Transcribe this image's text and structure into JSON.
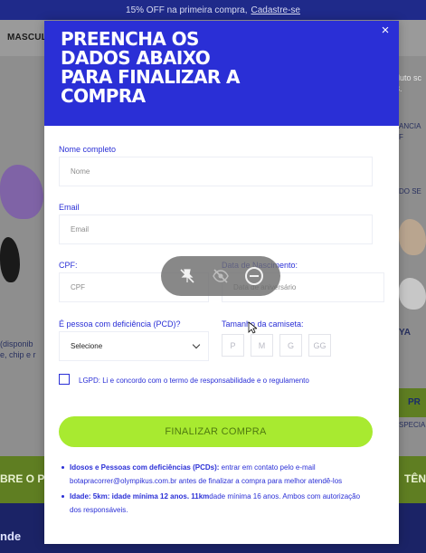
{
  "promo": {
    "text": "15% OFF na primeira compra,",
    "link": "Cadastre-se"
  },
  "background": {
    "nav_left": "MASCULI",
    "right_note": "duto sc 3.",
    "right_tab": "ANCIA F",
    "right_de": "DO SE",
    "left_text_1": "(disponib",
    "left_text_2": "e, chip e r",
    "right_ya": "YA",
    "right_btn": "PR",
    "right_special": "SPECIA",
    "green_left": "BRE O P",
    "green_right": "TÊN",
    "bottom_left": "nde"
  },
  "modal": {
    "title": "PREENCHA OS DADOS ABAIXO PARA FINALIZAR A COMPRA",
    "close_label": "×",
    "fields": {
      "name": {
        "label": "Nome completo",
        "placeholder": "Nome"
      },
      "email": {
        "label": "Email",
        "placeholder": "Email"
      },
      "cpf": {
        "label": "CPF:",
        "placeholder": "CPF"
      },
      "birth": {
        "label": "Data de Nascimento:",
        "placeholder": "Data de aniversário"
      },
      "pcd": {
        "label": "É pessoa com deficiência (PCD)?",
        "value": "Selecione"
      },
      "shirt": {
        "label": "Tamanho da camiseta:",
        "sizes": [
          "P",
          "M",
          "G",
          "GG"
        ]
      }
    },
    "lgpd": "LGPD: Li e concordo com o termo de responsabilidade e o regulamento",
    "submit": "FINALIZAR COMPRA",
    "notes": [
      {
        "bold": "Idosos e Pessoas com deficiências (PCDs):",
        "text": " entrar em contato pelo e-mail botapracorrer@olympikus.com.br antes de finalizar a compra para melhor atendê-los"
      },
      {
        "bold": "Idade: 5km: idade mínima 12 anos. 11km",
        "text": "dade mínima 16 anos. Ambos com autorização dos responsáveis."
      }
    ]
  },
  "toolbar": {
    "icons": [
      "pin-off-icon",
      "eye-off-icon",
      "minus-circle-icon"
    ]
  },
  "colors": {
    "brand_blue": "#2a2fd6",
    "accent_green": "#a8ea30"
  }
}
